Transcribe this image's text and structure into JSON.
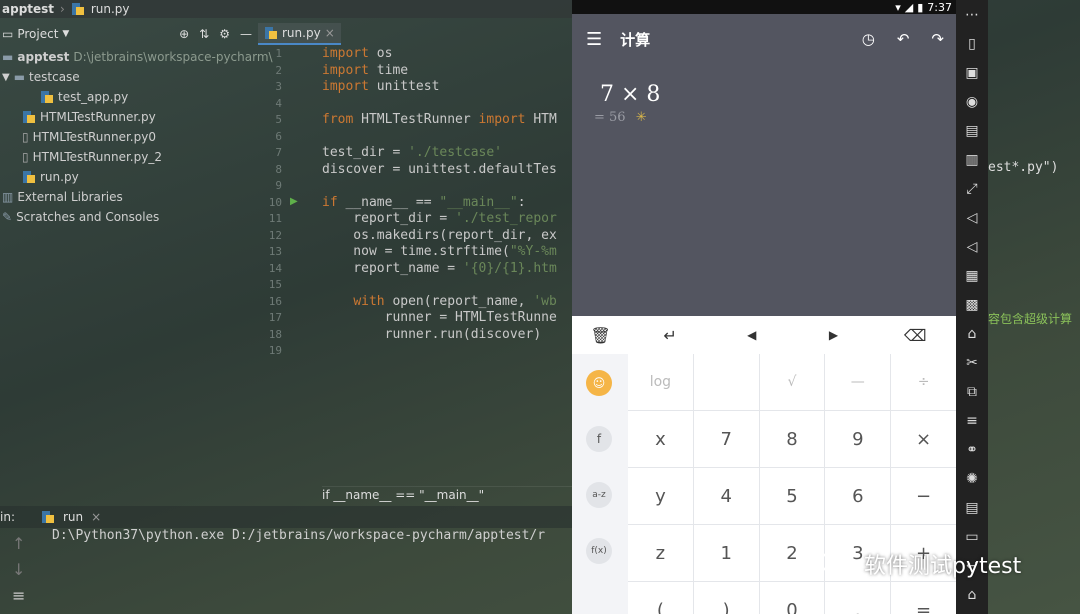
{
  "ide": {
    "breadcrumb_project": "apptest",
    "breadcrumb_file": "run.py",
    "project_label": "Project",
    "editor_tab": "run.py",
    "tree": [
      {
        "label": "apptest",
        "detail": "D:\\jetbrains\\workspace-pycharm\\",
        "bold": true
      },
      {
        "label": "testcase"
      },
      {
        "label": "test_app.py"
      },
      {
        "label": "HTMLTestRunner.py"
      },
      {
        "label": "HTMLTestRunner.py0"
      },
      {
        "label": "HTMLTestRunner.py_2"
      },
      {
        "label": "run.py"
      },
      {
        "label": "External Libraries"
      },
      {
        "label": "Scratches and Consoles"
      }
    ],
    "line_numbers": [
      "1",
      "2",
      "3",
      "4",
      "5",
      "6",
      "7",
      "8",
      "9",
      "10",
      "11",
      "12",
      "13",
      "14",
      "15",
      "16",
      "17",
      "18",
      "19"
    ],
    "code_lines": [
      "import os",
      "import time",
      "import unittest",
      "",
      "from HTMLTestRunner import HTM",
      "",
      "test_dir = './testcase'",
      "discover = unittest.defaultTes",
      "",
      "if __name__ == \"__main__\":",
      "    report_dir = './test_repor",
      "    os.makedirs(report_dir, ex",
      "    now = time.strftime(\"%Y-%m",
      "    report_name = '{0}/{1}.htm",
      "",
      "    with open(report_name, 'wb",
      "        runner = HTMLTestRunne",
      "        runner.run(discover)",
      ""
    ],
    "editor_crumb": "if __name__ == \"__main__\"",
    "run_label": "in:",
    "run_tab": "run",
    "console_line": "D:\\Python37\\python.exe D:/jetbrains/workspace-pycharm/apptest/r",
    "right_text_1": "est*.py\")",
    "right_text_2": "容包含超级计算"
  },
  "phone": {
    "time": "7:37",
    "app_title": "计算",
    "expression": "7 × 8",
    "result": "= 56",
    "edit_bar": [
      "🗑",
      "↵",
      "◀",
      "▶",
      "⌫"
    ],
    "func_keys": [
      "☺",
      "f",
      "a-z",
      "f(x)",
      ""
    ],
    "keys": [
      [
        "log",
        "",
        "√",
        "—",
        "÷"
      ],
      [
        "x",
        "7",
        "8",
        "9",
        "×"
      ],
      [
        "y",
        "4",
        "5",
        "6",
        "−"
      ],
      [
        "z",
        "1",
        "2",
        "3",
        "+"
      ],
      [
        "(",
        ")",
        "0",
        ".",
        "="
      ]
    ]
  },
  "watermark": "软件测试pytest",
  "colors": {
    "accent": "#4a88c7",
    "keyword": "#cc7832",
    "string": "#6a8759",
    "face_key": "#f5b547"
  }
}
